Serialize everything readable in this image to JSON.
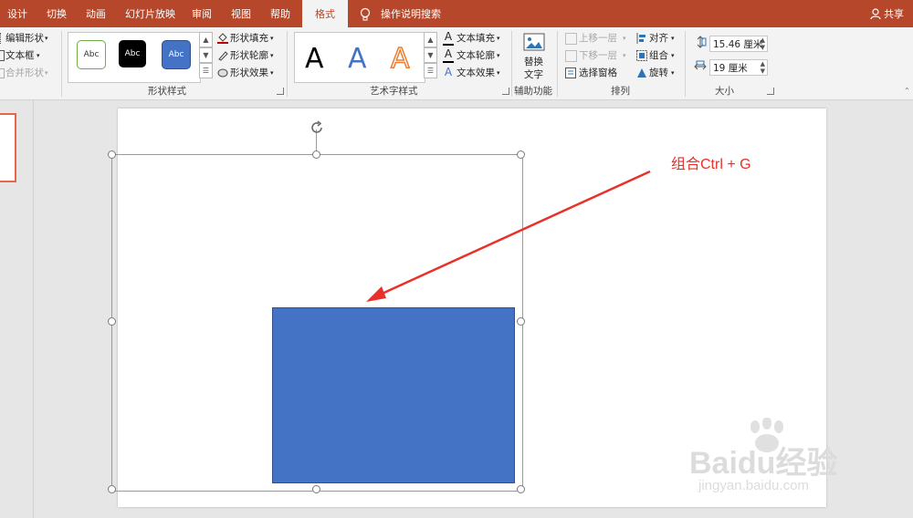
{
  "tabs": [
    {
      "label": "设计",
      "active": false
    },
    {
      "label": "切换",
      "active": false
    },
    {
      "label": "动画",
      "active": false
    },
    {
      "label": "幻灯片放映",
      "active": false
    },
    {
      "label": "审阅",
      "active": false
    },
    {
      "label": "视图",
      "active": false
    },
    {
      "label": "帮助",
      "active": false
    },
    {
      "label": "格式",
      "active": true
    }
  ],
  "tell_me": {
    "icon": "lightbulb-icon",
    "label": "操作说明搜索"
  },
  "share": {
    "icon": "person-icon",
    "label": "共享"
  },
  "insert_shapes": {
    "edit_shape": "编辑形状",
    "text_box": "文本框",
    "merge_shapes": "合并形状"
  },
  "shape_styles": {
    "group_label": "形状样式",
    "swatches": [
      "Abc",
      "Abc",
      "Abc"
    ],
    "fill": "形状填充",
    "outline": "形状轮廓",
    "effects": "形状效果"
  },
  "wordart": {
    "group_label": "艺术字样式",
    "letters": [
      "A",
      "A",
      "A"
    ],
    "text_fill": "文本填充",
    "text_outline": "文本轮廓",
    "text_effects": "文本效果"
  },
  "accessibility": {
    "group_label": "辅助功能",
    "alt_text_line1": "替换",
    "alt_text_line2": "文字"
  },
  "arrange": {
    "group_label": "排列",
    "bring_forward": "上移一层",
    "send_backward": "下移一层",
    "selection_pane": "选择窗格",
    "align": "对齐",
    "group": "组合",
    "rotate": "旋转"
  },
  "size": {
    "group_label": "大小",
    "height": "15.46 厘米",
    "width": "19 厘米"
  },
  "annotation": "组合Ctrl + G",
  "watermark": {
    "brand": "Baidu经验",
    "url": "jingyan.baidu.com"
  },
  "colors": {
    "accent": "#b7472a",
    "shape_fill": "#4472c4",
    "annotation": "#e8312a"
  }
}
